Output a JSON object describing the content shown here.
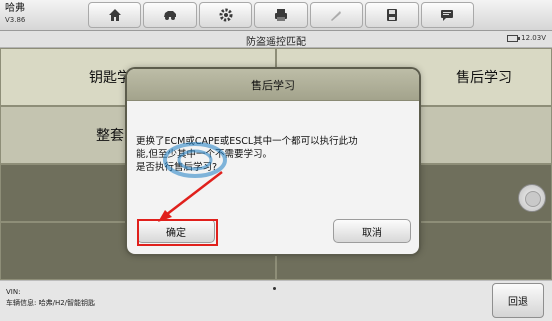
{
  "app": {
    "brand": "哈弗",
    "version": "V3.86"
  },
  "toolbar": {
    "icons": [
      "home-icon",
      "vehicle-icon",
      "settings-icon",
      "print-icon",
      "tools-icon",
      "save-icon",
      "message-icon"
    ]
  },
  "subbar": {
    "title": "防盗遥控匹配",
    "battery_voltage": "12.03V"
  },
  "grid": {
    "key_learning_label": "钥匙学习（下线",
    "after_sales_label": "售后学习",
    "full_system_label": "整套系统学习"
  },
  "dialog": {
    "title": "售后学习",
    "message_lines": [
      "更换了ECM或CAPE或ESCL其中一个都可以执行此功",
      "能,但至少其中一个不需要学习。",
      "是否执行售后学习?"
    ],
    "ok_label": "确定",
    "cancel_label": "取消"
  },
  "footer": {
    "vin_label": "VIN:",
    "vehicle_info": "车辆信息: 哈弗/H2/智能钥匙",
    "back_label": "回退"
  },
  "colors": {
    "highlight": "#e0201c",
    "panel": "#d9d9c4",
    "dark_panel": "#6f6f5c"
  }
}
